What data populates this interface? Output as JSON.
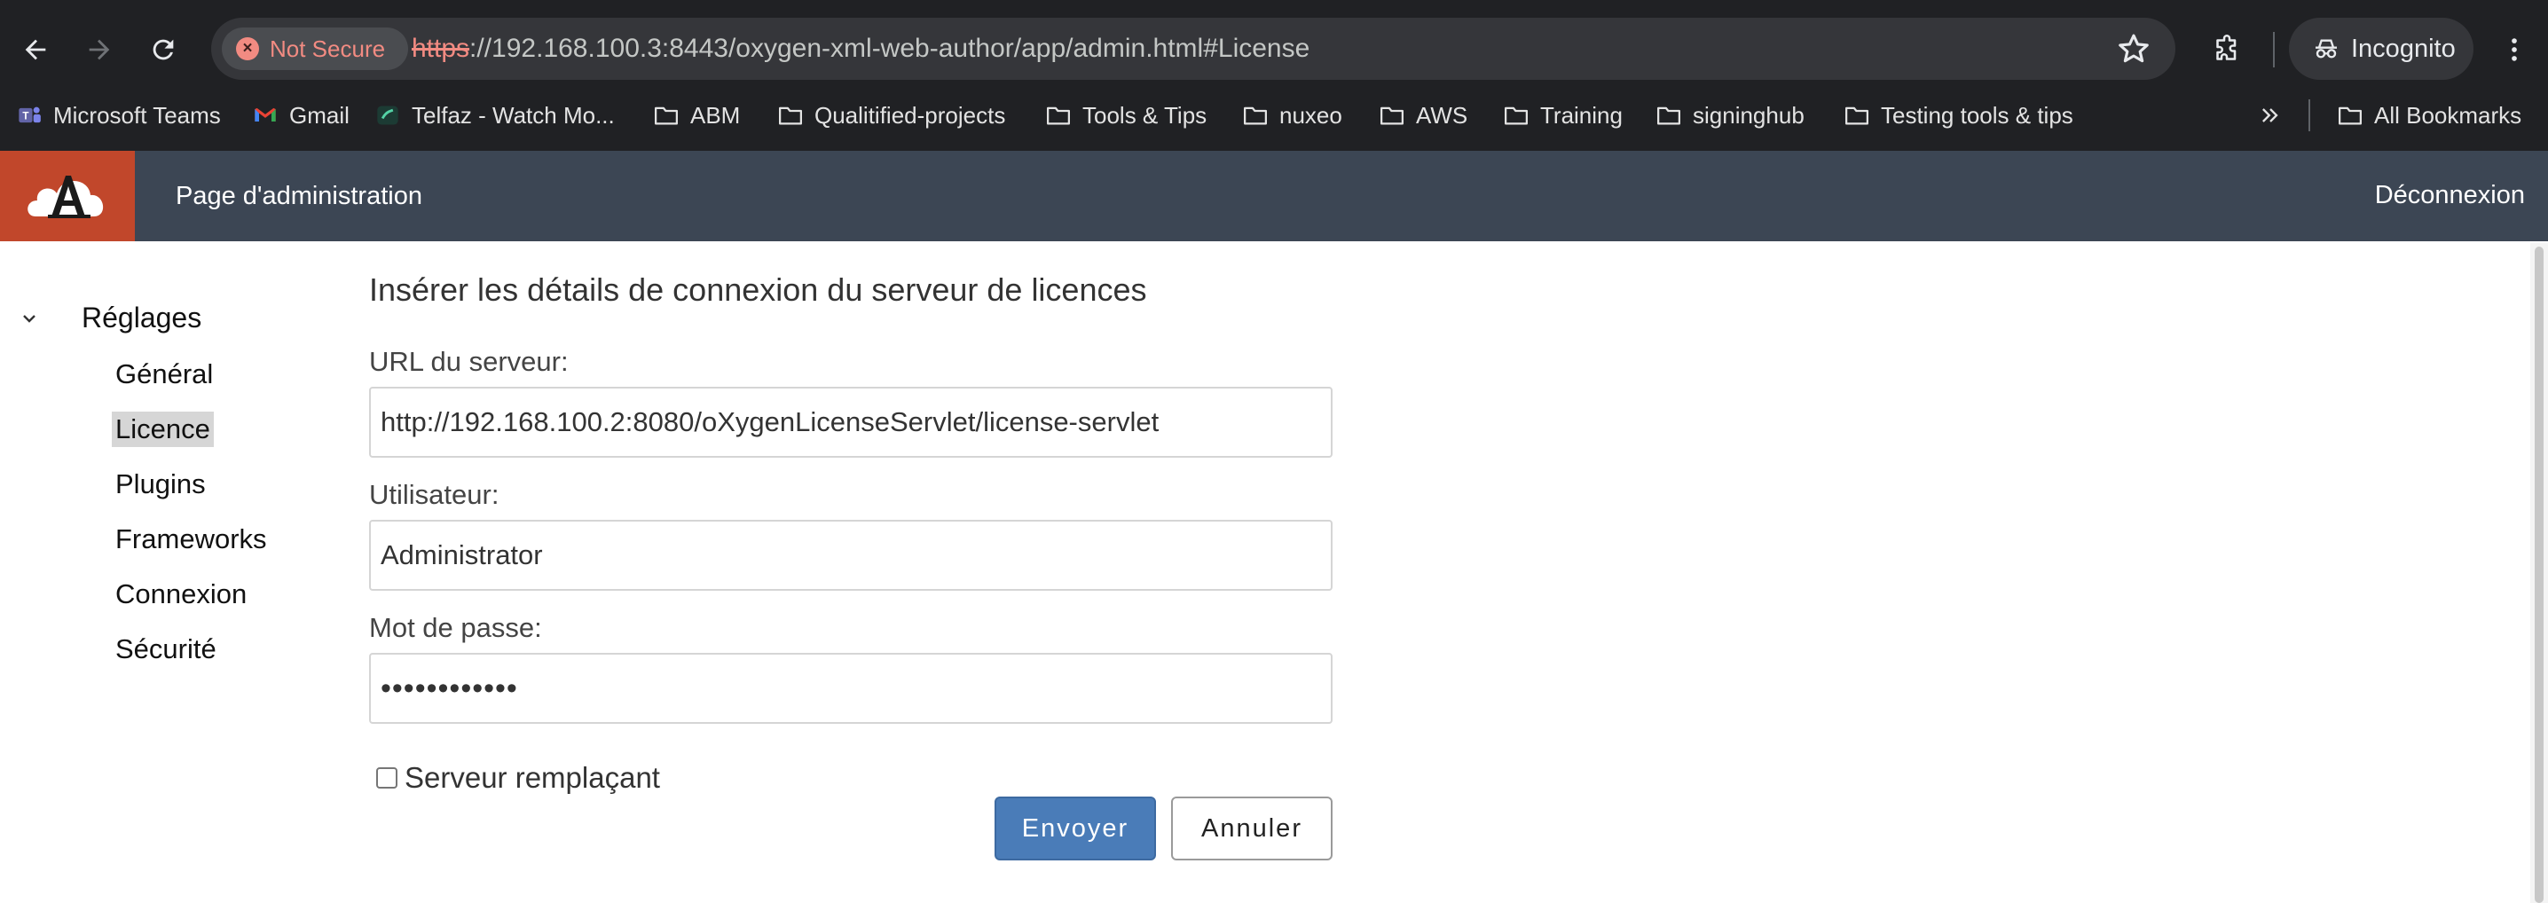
{
  "browser": {
    "security_chip": "Not Secure",
    "url_scheme": "https",
    "url_rest": "://192.168.100.3:8443/oxygen-xml-web-author/app/admin.html#License",
    "profile_label": "Incognito",
    "icons": [
      "back-arrow-icon",
      "forward-arrow-icon",
      "reload-icon",
      "warning-icon",
      "star-icon",
      "extensions-icon",
      "incognito-icon",
      "kebab-menu-icon"
    ],
    "colors": {
      "frame": "#202124",
      "omnibox": "#35363a",
      "warning": "#f28b82"
    }
  },
  "bookmarks": {
    "items": [
      "Microsoft Teams",
      "Gmail",
      "Telfaz - Watch Mo...",
      "ABM",
      "Qualitified-projects",
      "Tools & Tips",
      "nuxeo",
      "AWS",
      "Training",
      "signinghub",
      "Testing tools & tips"
    ],
    "overflow_icon": "chevron-double-right-icon",
    "all_bookmarks": "All Bookmarks"
  },
  "app": {
    "title": "Page d'administration",
    "logout": "Déconnexion",
    "colors": {
      "header": "#3c4654",
      "logo": "#c1472b",
      "primary": "#4a7cb8"
    }
  },
  "sidebar": {
    "root": "Réglages",
    "items": [
      "Général",
      "Licence",
      "Plugins",
      "Frameworks",
      "Connexion",
      "Sécurité"
    ],
    "selected": "Licence"
  },
  "form": {
    "title": "Insérer les détails de connexion du serveur de licences",
    "server_url_label": "URL du serveur:",
    "server_url_value": "http://192.168.100.2:8080/oXygenLicenseServlet/license-servlet",
    "user_label": "Utilisateur:",
    "user_value": "Administrator",
    "password_label": "Mot de passe:",
    "password_value": "••••••••••••",
    "backup_label": "Serveur remplaçant",
    "backup_checked": false,
    "submit": "Envoyer",
    "cancel": "Annuler"
  }
}
